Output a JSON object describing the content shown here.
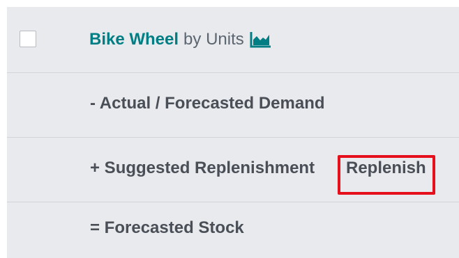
{
  "product_row": {
    "product_name": "Bike Wheel",
    "unit_label": "by Units",
    "graph_icon": "area-chart-icon"
  },
  "demand_row": {
    "label": "- Actual / Forecasted Demand"
  },
  "replenishment_row": {
    "label": "+ Suggested Replenishment",
    "button_label": "Replenish"
  },
  "stock_row": {
    "label": "= Forecasted Stock"
  },
  "colors": {
    "panel_background": "#e9eaed",
    "link_teal": "#017e84",
    "highlight_red": "#e5101c",
    "text_dark": "#4a4f57"
  }
}
